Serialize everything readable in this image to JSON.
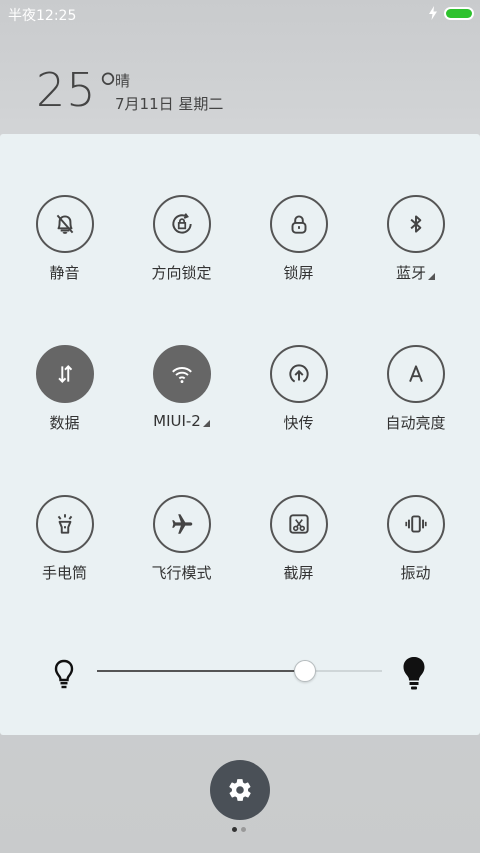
{
  "status_bar": {
    "time": "半夜12:25"
  },
  "weather": {
    "temperature": "25°",
    "condition": "晴",
    "date": "7月11日 星期二"
  },
  "toggles": [
    {
      "label": "静音",
      "icon": "bell-off-icon",
      "active": false,
      "has_more": false
    },
    {
      "label": "方向锁定",
      "icon": "rotation-lock-icon",
      "active": false,
      "has_more": false
    },
    {
      "label": "锁屏",
      "icon": "lock-icon",
      "active": false,
      "has_more": false
    },
    {
      "label": "蓝牙",
      "icon": "bluetooth-icon",
      "active": false,
      "has_more": true
    },
    {
      "label": "数据",
      "icon": "data-arrows-icon",
      "active": true,
      "has_more": false
    },
    {
      "label": "MIUI-2",
      "icon": "wifi-icon",
      "active": true,
      "has_more": true
    },
    {
      "label": "快传",
      "icon": "quick-transfer-icon",
      "active": false,
      "has_more": false
    },
    {
      "label": "自动亮度",
      "icon": "auto-brightness-icon",
      "active": false,
      "has_more": false
    },
    {
      "label": "手电筒",
      "icon": "flashlight-icon",
      "active": false,
      "has_more": false
    },
    {
      "label": "飞行模式",
      "icon": "airplane-icon",
      "active": false,
      "has_more": false
    },
    {
      "label": "截屏",
      "icon": "screenshot-icon",
      "active": false,
      "has_more": false
    },
    {
      "label": "振动",
      "icon": "vibrate-icon",
      "active": false,
      "has_more": false
    }
  ],
  "brightness": {
    "level": 0.73,
    "low_icon": "bulb-outline-icon",
    "high_icon": "bulb-filled-icon"
  },
  "settings": {
    "icon": "gear-icon"
  },
  "pagination": {
    "pages": 2,
    "current": 1
  },
  "colors": {
    "panel": "#eaf1f3",
    "active_toggle": "#666666",
    "battery": "#2ec22e",
    "settings_button": "#4a5057"
  }
}
